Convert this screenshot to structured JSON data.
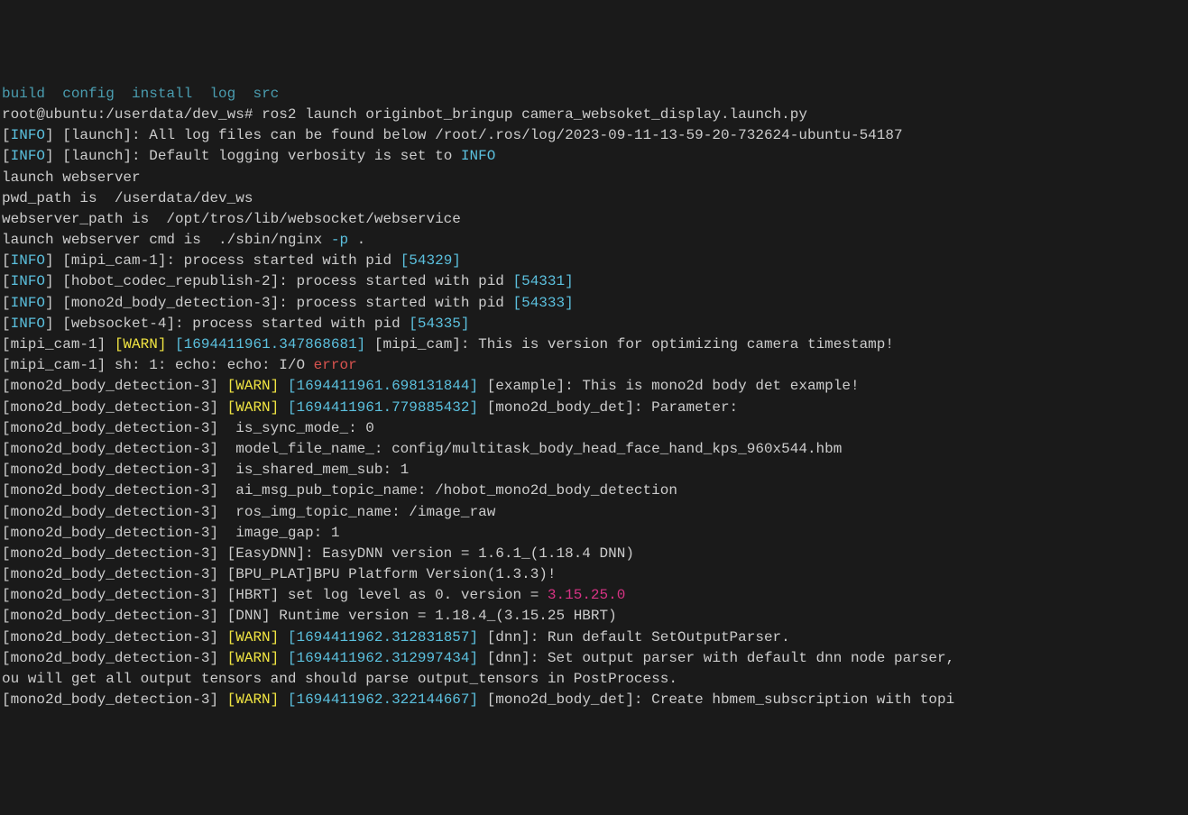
{
  "header_dirs": {
    "build": "build",
    "config": "config",
    "install": "install",
    "log": "log",
    "src": "src"
  },
  "prompt": {
    "user_host": "root@ubuntu",
    "path": ":/userdata/dev_ws#",
    "command": "ros2 launch originbot_bringup camera_websoket_display.launch.py"
  },
  "lines": {
    "l1_info": "INFO",
    "l1_text": "] [launch]: All log files can be found below /root/.ros/log/2023-09-11-13-59-20-732624-ubuntu-54187",
    "l2_info": "INFO",
    "l2_a": "] [launch]: Default logging verbosity is set to ",
    "l2_b": "INFO",
    "l3": "launch webserver",
    "l4": "pwd_path is  /userdata/dev_ws",
    "l5": "webserver_path is  /opt/tros/lib/websocket/webservice",
    "l6_a": "launch webserver cmd is  ./sbin/nginx ",
    "l6_b": "-p",
    "l6_c": " .",
    "l7_info": "INFO",
    "l7_a": "] [mipi_cam-1]: process started with pid ",
    "l7_b": "[54329]",
    "l8_info": "INFO",
    "l8_a": "] [hobot_codec_republish-2]: process started with pid ",
    "l8_b": "[54331]",
    "l9_info": "INFO",
    "l9_a": "] [mono2d_body_detection-3]: process started with pid ",
    "l9_b": "[54333]",
    "l10_info": "INFO",
    "l10_a": "] [websocket-4]: process started with pid ",
    "l10_b": "[54335]",
    "l11_a": "[mipi_cam-1] ",
    "l11_warn": "[WARN]",
    "l11_ts": "[1694411961.347868681]",
    "l11_b": " [mipi_cam]: This is version for optimizing camera timestamp!",
    "l12_a": "[mipi_cam-1] sh: 1: echo: echo: I/O ",
    "l12_err": "error",
    "l13_a": "[mono2d_body_detection-3] ",
    "l13_warn": "[WARN]",
    "l13_ts": "[1694411961.698131844]",
    "l13_b": " [example]: This is mono2d body det example!",
    "l14_a": "[mono2d_body_detection-3] ",
    "l14_warn": "[WARN]",
    "l14_ts": "[1694411961.779885432]",
    "l14_b": " [mono2d_body_det]: Parameter:",
    "l15": "[mono2d_body_detection-3]  is_sync_mode_: 0",
    "l16": "[mono2d_body_detection-3]  model_file_name_: config/multitask_body_head_face_hand_kps_960x544.hbm",
    "l17": "[mono2d_body_detection-3]  is_shared_mem_sub: 1",
    "l18": "[mono2d_body_detection-3]  ai_msg_pub_topic_name: /hobot_mono2d_body_detection",
    "l19": "[mono2d_body_detection-3]  ros_img_topic_name: /image_raw",
    "l20": "[mono2d_body_detection-3]  image_gap: 1",
    "l21": "[mono2d_body_detection-3] [EasyDNN]: EasyDNN version = 1.6.1_(1.18.4 DNN)",
    "l22": "[mono2d_body_detection-3] [BPU_PLAT]BPU Platform Version(1.3.3)!",
    "l23_a": "[mono2d_body_detection-3] [HBRT] set log level as 0. version = ",
    "l23_b": "3.15.25.0",
    "l24": "[mono2d_body_detection-3] [DNN] Runtime version = 1.18.4_(3.15.25 HBRT)",
    "l25_a": "[mono2d_body_detection-3] ",
    "l25_warn": "[WARN]",
    "l25_ts": "[1694411962.312831857]",
    "l25_b": " [dnn]: Run default SetOutputParser.",
    "l26_a": "[mono2d_body_detection-3] ",
    "l26_warn": "[WARN]",
    "l26_ts": "[1694411962.312997434]",
    "l26_b": " [dnn]: Set output parser with default dnn node parser,",
    "l27": "ou will get all output tensors and should parse output_tensors in PostProcess.",
    "l28_a": "[mono2d_body_detection-3] ",
    "l28_warn": "[WARN]",
    "l28_ts": "[1694411962.322144667]",
    "l28_b": " [mono2d_body_det]: Create hbmem_subscription with topi"
  }
}
